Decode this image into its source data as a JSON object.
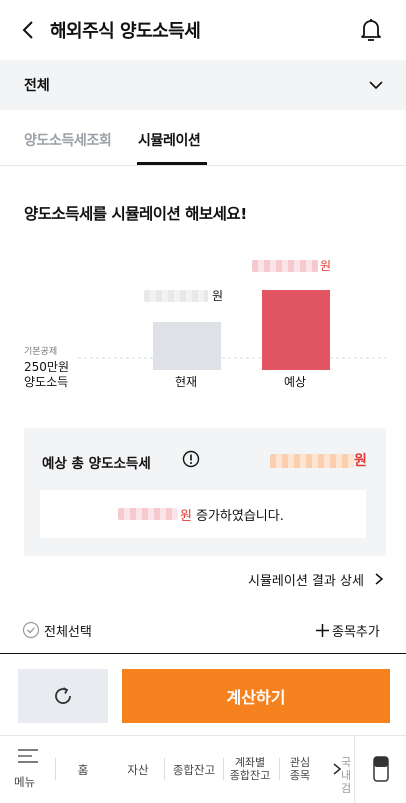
{
  "header": {
    "title": "해외주식 양도소득세"
  },
  "account": {
    "label": "전체"
  },
  "tabs": [
    {
      "label": "양도소득세조회",
      "active": false
    },
    {
      "label": "시뮬레이션",
      "active": true
    }
  ],
  "headline": "양도소득세를 시뮬레이션 해보세요!",
  "chart_data": {
    "type": "bar",
    "categories": [
      "현재",
      "예상"
    ],
    "unit_labels": [
      "원",
      "원"
    ],
    "baseline": {
      "line1": "기본공제",
      "line2": "250만원",
      "line3": "양도소득"
    },
    "colors": [
      "#dee1e5",
      "#e05561"
    ]
  },
  "summary": {
    "label": "예상 총 양도소득세",
    "value_unit": "원",
    "change_unit": "원",
    "change_text": "증가하였습니다."
  },
  "detail_link": "시뮬레이션 결과 상세",
  "select_all": "전체선택",
  "add_item": "종목추가",
  "calc_button": "계산하기",
  "nav": {
    "menu": "메뉴",
    "items": [
      "홈",
      "자산",
      "종합잔고"
    ],
    "by_account": [
      "계좌별",
      "종합잔고"
    ],
    "watchlist": [
      "관심",
      "종목"
    ],
    "truncated": [
      "국내",
      "검"
    ]
  },
  "colors": {
    "accent": "#f5821f",
    "red": "#e53935"
  }
}
